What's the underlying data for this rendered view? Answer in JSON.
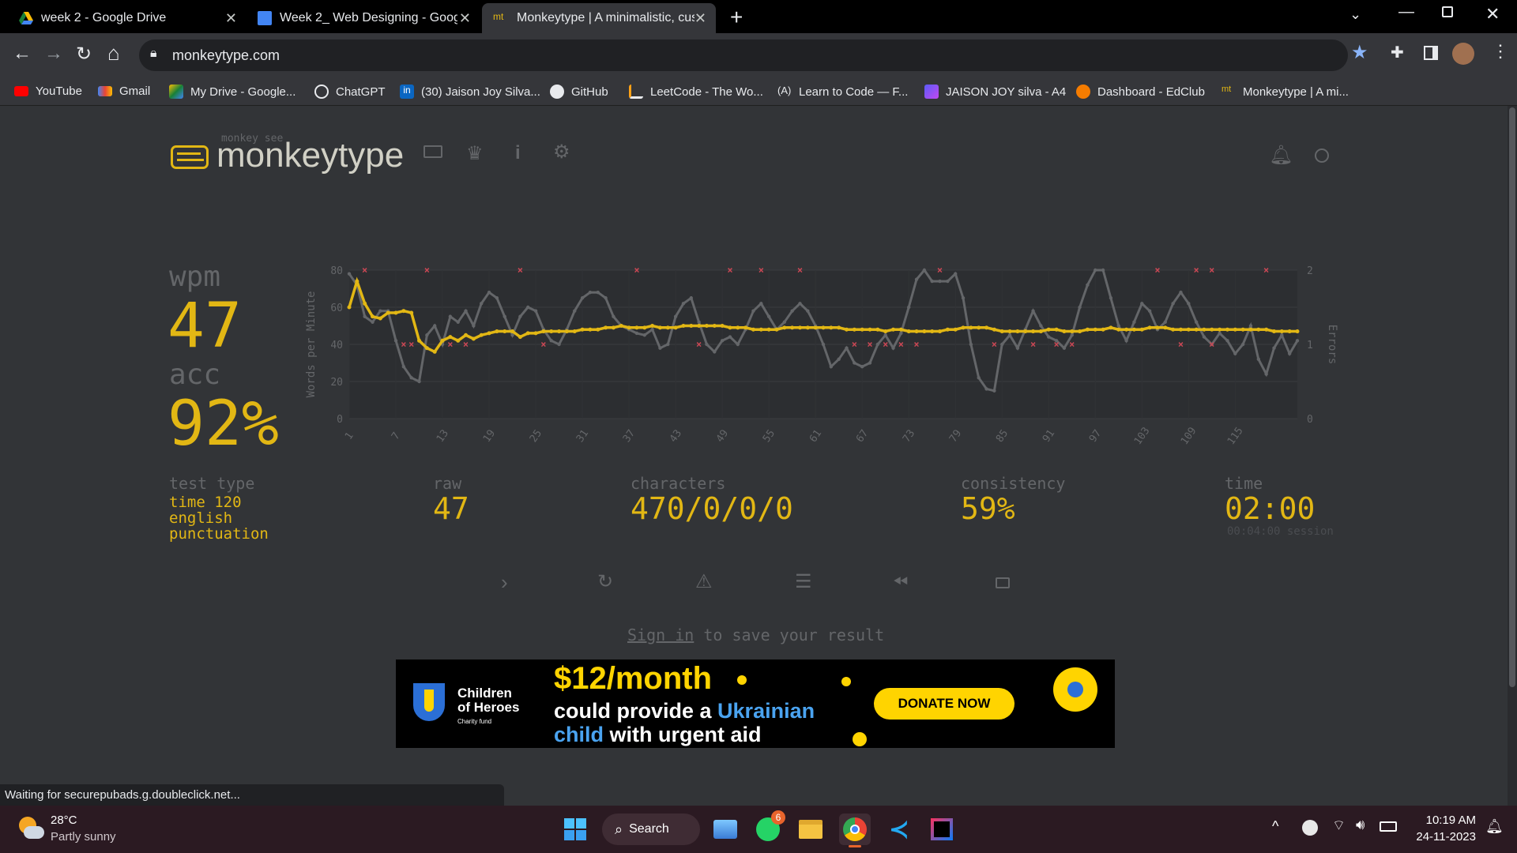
{
  "browser": {
    "tabs": [
      {
        "title": "week 2 - Google Drive",
        "active": false
      },
      {
        "title": "Week 2_ Web Designing - Goog",
        "active": false
      },
      {
        "title": "Monkeytype | A minimalistic, cus",
        "active": true
      }
    ],
    "url": "monkeytype.com",
    "bookmarks": [
      "YouTube",
      "Gmail",
      "My Drive - Google...",
      "ChatGPT",
      "(30) Jaison Joy Silva...",
      "GitHub",
      "LeetCode - The Wo...",
      "Learn to Code — F...",
      "JAISON JOY silva - A4",
      "Dashboard - EdClub",
      "Monkeytype | A mi..."
    ],
    "status": "Waiting for securepubads.g.doubleclick.net..."
  },
  "header": {
    "logo_top": "monkey see",
    "logo": "monkeytype"
  },
  "result": {
    "wpm_label": "wpm",
    "wpm": "47",
    "acc_label": "acc",
    "acc": "92%",
    "test_type_label": "test type",
    "test_type": [
      "time 120",
      "english",
      "punctuation"
    ],
    "raw_label": "raw",
    "raw": "47",
    "characters_label": "characters",
    "characters": "470/0/0/0",
    "consistency_label": "consistency",
    "consistency": "59%",
    "time_label": "time",
    "time": "02:00",
    "session": "00:04:00 session",
    "sign_in": "Sign in",
    "save_text": "to save your result"
  },
  "chart_data": {
    "type": "line",
    "ylabel": "Words per Minute",
    "y2label": "Errors",
    "ylim": [
      0,
      80
    ],
    "y2lim": [
      0,
      2
    ],
    "yticks": [
      0,
      20,
      40,
      60,
      80
    ],
    "y2ticks": [
      0,
      1,
      2
    ],
    "xticks": [
      1,
      7,
      13,
      19,
      25,
      31,
      37,
      43,
      49,
      55,
      61,
      67,
      73,
      79,
      85,
      91,
      97,
      103,
      109,
      115
    ],
    "series": [
      {
        "name": "raw",
        "color": "#646669",
        "values": [
          78,
          72,
          55,
          52,
          58,
          58,
          42,
          28,
          22,
          20,
          45,
          50,
          40,
          55,
          52,
          58,
          50,
          62,
          68,
          65,
          55,
          45,
          55,
          60,
          58,
          48,
          42,
          40,
          48,
          58,
          65,
          68,
          68,
          65,
          55,
          50,
          48,
          46,
          45,
          48,
          38,
          40,
          55,
          62,
          65,
          52,
          40,
          36,
          42,
          44,
          40,
          48,
          58,
          62,
          55,
          48,
          52,
          58,
          62,
          58,
          50,
          40,
          28,
          32,
          38,
          30,
          28,
          30,
          40,
          45,
          38,
          46,
          60,
          75,
          80,
          74,
          74,
          74,
          78,
          65,
          40,
          22,
          16,
          15,
          40,
          45,
          38,
          48,
          58,
          50,
          44,
          42,
          38,
          45,
          60,
          72,
          80,
          80,
          65,
          50,
          42,
          52,
          62,
          58,
          48,
          52,
          62,
          68,
          62,
          52,
          44,
          40,
          46,
          42,
          35,
          40,
          50,
          32,
          24,
          38,
          45,
          35,
          42
        ],
        "display_only": true
      },
      {
        "name": "wpm",
        "color": "#e2b714",
        "values": [
          60,
          74,
          62,
          55,
          54,
          57,
          57,
          58,
          57,
          42,
          38,
          36,
          42,
          44,
          42,
          45,
          43,
          45,
          46,
          47,
          47,
          47,
          44,
          46,
          46,
          47,
          47,
          47,
          47,
          47,
          48,
          48,
          48,
          49,
          49,
          50,
          49,
          49,
          49,
          50,
          49,
          49,
          49,
          50,
          50,
          50,
          50,
          50,
          50,
          49,
          49,
          49,
          48,
          48,
          48,
          48,
          49,
          49,
          49,
          49,
          49,
          49,
          49,
          49,
          48,
          48,
          48,
          48,
          48,
          47,
          48,
          48,
          47,
          47,
          47,
          47,
          47,
          48,
          48,
          49,
          49,
          49,
          49,
          48,
          47,
          47,
          47,
          47,
          47,
          47,
          48,
          48,
          47,
          47,
          47,
          48,
          48,
          48,
          49,
          48,
          48,
          48,
          48,
          49,
          49,
          49,
          48,
          48,
          48,
          48,
          48,
          48,
          48,
          48,
          48,
          48,
          48,
          48,
          48,
          47,
          47,
          47,
          47
        ]
      },
      {
        "name": "errors",
        "color": "#ca4754",
        "points": [
          [
            3,
            2
          ],
          [
            8,
            1
          ],
          [
            9,
            1
          ],
          [
            11,
            2
          ],
          [
            14,
            1
          ],
          [
            16,
            1
          ],
          [
            23,
            2
          ],
          [
            26,
            1
          ],
          [
            38,
            2
          ],
          [
            46,
            1
          ],
          [
            50,
            2
          ],
          [
            54,
            2
          ],
          [
            59,
            2
          ],
          [
            66,
            1
          ],
          [
            68,
            1
          ],
          [
            70,
            1
          ],
          [
            72,
            1
          ],
          [
            74,
            1
          ],
          [
            77,
            2
          ],
          [
            84,
            1
          ],
          [
            89,
            1
          ],
          [
            92,
            1
          ],
          [
            94,
            1
          ],
          [
            105,
            2
          ],
          [
            108,
            1
          ],
          [
            110,
            2
          ],
          [
            112,
            2
          ],
          [
            112,
            1
          ],
          [
            119,
            2
          ]
        ]
      }
    ]
  },
  "ad": {
    "org_line1": "Children",
    "org_line2": "of Heroes",
    "org_line3": "Charity fund",
    "price": "$12/month",
    "line1a": "could provide a ",
    "line1b": "Ukrainian",
    "line2a": "child",
    "line2b": " with urgent aid",
    "cta": "DONATE NOW"
  },
  "taskbar": {
    "temp": "28°C",
    "weather": "Partly sunny",
    "search": "Search",
    "whatsapp_badge": "6",
    "time": "10:19 AM",
    "date": "24-11-2023"
  },
  "colors": {
    "bg": "#323437",
    "main": "#e2b714",
    "sub": "#646669",
    "text": "#d1d0c5",
    "error": "#ca4754"
  }
}
